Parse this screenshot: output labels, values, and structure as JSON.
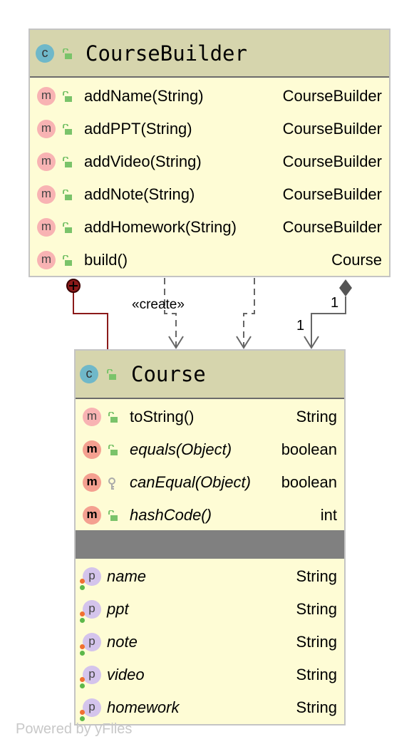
{
  "builder": {
    "name": "CourseBuilder",
    "methods": [
      {
        "name": "addName(String)",
        "type": "CourseBuilder",
        "icon": "method-icon",
        "visibility": "public"
      },
      {
        "name": "addPPT(String)",
        "type": "CourseBuilder",
        "icon": "method-icon",
        "visibility": "public"
      },
      {
        "name": "addVideo(String)",
        "type": "CourseBuilder",
        "icon": "method-icon",
        "visibility": "public"
      },
      {
        "name": "addNote(String)",
        "type": "CourseBuilder",
        "icon": "method-icon",
        "visibility": "public"
      },
      {
        "name": "addHomework(String)",
        "type": "CourseBuilder",
        "icon": "method-icon",
        "visibility": "public"
      },
      {
        "name": "build()",
        "type": "Course",
        "icon": "method-icon",
        "visibility": "public"
      }
    ]
  },
  "course": {
    "name": "Course",
    "methods": [
      {
        "name": "toString()",
        "type": "String",
        "icon": "method-icon",
        "visibility": "public",
        "italic": false
      },
      {
        "name": "equals(Object)",
        "type": "boolean",
        "icon": "lombok-method-icon",
        "visibility": "public",
        "italic": true
      },
      {
        "name": "canEqual(Object)",
        "type": "boolean",
        "icon": "lombok-method-icon",
        "visibility": "protected",
        "italic": true
      },
      {
        "name": "hashCode()",
        "type": "int",
        "icon": "lombok-method-icon",
        "visibility": "public",
        "italic": true
      }
    ],
    "fields": [
      {
        "name": "name",
        "type": "String"
      },
      {
        "name": "ppt",
        "type": "String"
      },
      {
        "name": "note",
        "type": "String"
      },
      {
        "name": "video",
        "type": "String"
      },
      {
        "name": "homework",
        "type": "String"
      }
    ]
  },
  "edges": {
    "create_label": "«create»",
    "mult_source": "1",
    "mult_target": "1"
  },
  "footer": "Powered by yFiles",
  "colors": {
    "header": "#d6d5ad",
    "body": "#fefcd5",
    "class_icon": "#6fb8c9",
    "method_icon": "#f8b3b3",
    "lombok_icon": "#f4a090",
    "field_icon": "#d4c4ec",
    "lock": "#7ac36a",
    "inner_edge": "#8b1a1a"
  }
}
